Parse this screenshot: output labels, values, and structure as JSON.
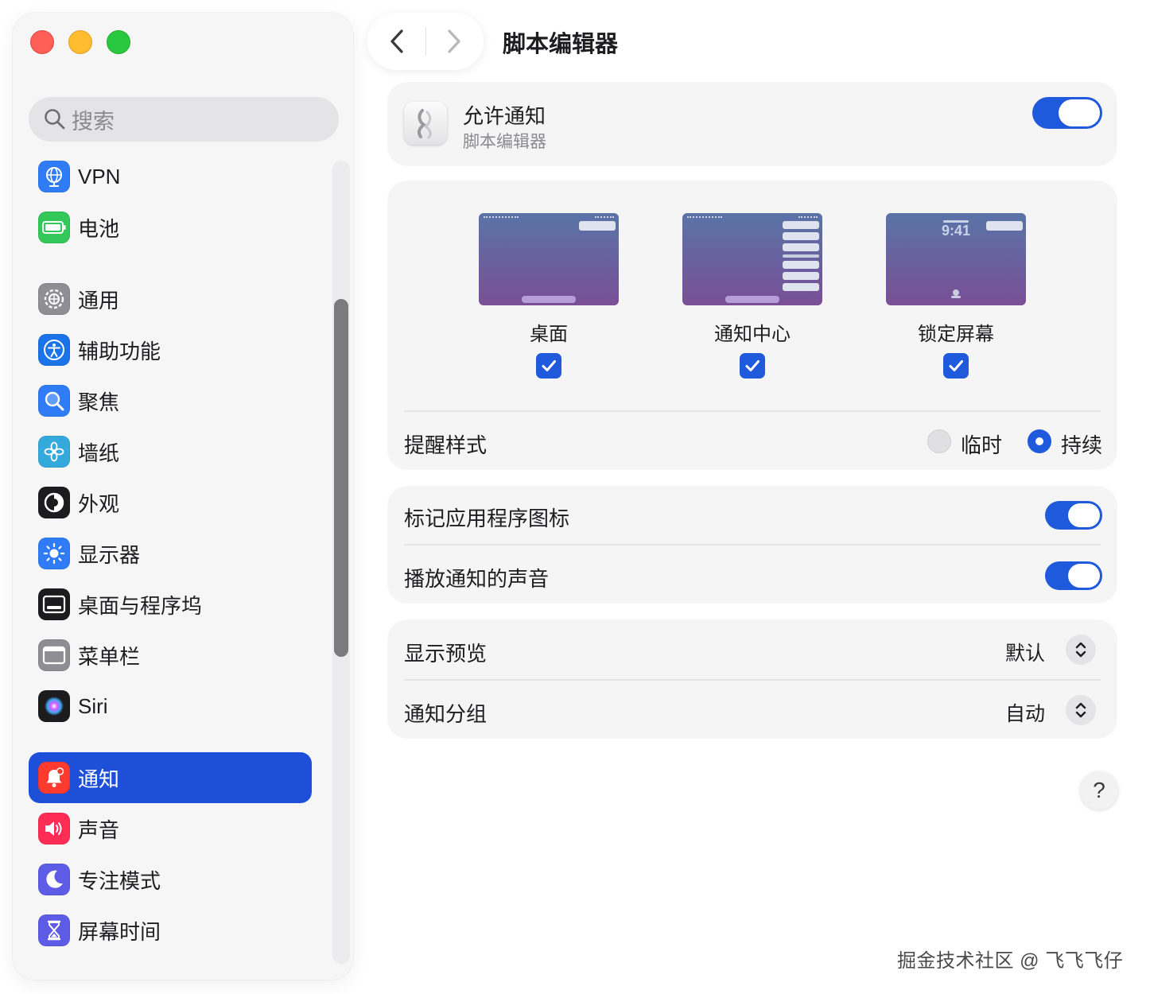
{
  "window": {
    "title": "脚本编辑器"
  },
  "sidebar": {
    "search_placeholder": "搜索",
    "items": [
      {
        "label": "VPN",
        "icon": "globe-icon",
        "color": "#2f7cf6"
      },
      {
        "label": "电池",
        "icon": "battery-icon",
        "color": "#34c759"
      },
      {
        "label": "通用",
        "icon": "gear-icon",
        "color": "#8e8e93"
      },
      {
        "label": "辅助功能",
        "icon": "accessibility-icon",
        "color": "#1a73e8"
      },
      {
        "label": "聚焦",
        "icon": "magnifier-icon",
        "color": "#2f7cf6"
      },
      {
        "label": "墙纸",
        "icon": "flower-icon",
        "color": "#34aadc"
      },
      {
        "label": "外观",
        "icon": "appearance-icon",
        "color": "#1c1c1e"
      },
      {
        "label": "显示器",
        "icon": "sun-icon",
        "color": "#2f7cf6"
      },
      {
        "label": "桌面与程序坞",
        "icon": "dock-icon",
        "color": "#1c1c1e"
      },
      {
        "label": "菜单栏",
        "icon": "menubar-icon",
        "color": "#8e8e93"
      },
      {
        "label": "Siri",
        "icon": "siri-icon",
        "color": "#1c1c1e"
      },
      {
        "label": "通知",
        "icon": "bell-icon",
        "color": "#ff3b30",
        "active": true
      },
      {
        "label": "声音",
        "icon": "speaker-icon",
        "color": "#ff2d55"
      },
      {
        "label": "专注模式",
        "icon": "moon-icon",
        "color": "#5e5ce6"
      },
      {
        "label": "屏幕时间",
        "icon": "hourglass-icon",
        "color": "#5e5ce6"
      }
    ]
  },
  "allow": {
    "title": "允许通知",
    "subtitle": "脚本编辑器",
    "enabled": true
  },
  "styles": {
    "previews": [
      {
        "label": "桌面",
        "checked": true
      },
      {
        "label": "通知中心",
        "checked": true
      },
      {
        "label": "锁定屏幕",
        "checked": true,
        "time": "9:41"
      }
    ],
    "alert_style_label": "提醒样式",
    "options": [
      {
        "label": "临时",
        "selected": false
      },
      {
        "label": "持续",
        "selected": true
      }
    ]
  },
  "toggles": [
    {
      "label": "标记应用程序图标",
      "enabled": true
    },
    {
      "label": "播放通知的声音",
      "enabled": true
    }
  ],
  "selects": [
    {
      "label": "显示预览",
      "value": "默认"
    },
    {
      "label": "通知分组",
      "value": "自动"
    }
  ],
  "help_label": "?",
  "watermark": "掘金技术社区 @ 飞飞飞仔",
  "accent_color": "#1f59dc"
}
